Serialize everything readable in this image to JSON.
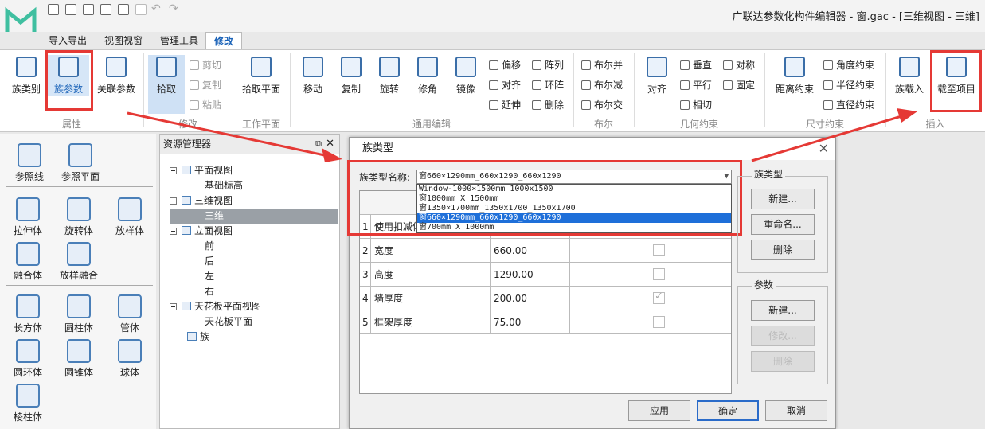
{
  "window": {
    "title": "广联达参数化构件编辑器 - 窗.gac - [三维视图 - 三维]"
  },
  "tabs": [
    "导入导出",
    "视图视窗",
    "管理工具",
    "修改"
  ],
  "ribbon": {
    "groups": {
      "attr": "属性",
      "modify": "修改",
      "workplane": "工作平面",
      "edit": "通用编辑",
      "bool": "布尔",
      "geo": "几何约束",
      "dim": "尺寸约束",
      "insert": "插入"
    },
    "family_category": "族类别",
    "family_params": "族参数",
    "linked_params": "关联参数",
    "pick": "拾取",
    "cut": "剪切",
    "copy": "复制",
    "paste": "粘贴",
    "pick_plane": "拾取平面",
    "move": "移动",
    "duplicate": "复制",
    "rotate": "旋转",
    "trim": "修角",
    "mirror": "镜像",
    "offset": "偏移",
    "align_small": "对齐",
    "extend": "延伸",
    "array": "阵列",
    "ring": "环阵",
    "delete": "删除",
    "bool_union": "布尔并",
    "bool_sub": "布尔减",
    "bool_inter": "布尔交",
    "align": "对齐",
    "perpendicular": "垂直",
    "parallel": "平行",
    "tangent": "相切",
    "symmetric": "对称",
    "fixed": "固定",
    "distance": "距离约束",
    "angle": "角度约束",
    "radius": "半径约束",
    "diameter": "直径约束",
    "load_family": "族载入",
    "load_to_project": "载至项目"
  },
  "left_panel": {
    "items": [
      "参照线",
      "参照平面",
      "拉伸体",
      "旋转体",
      "放样体",
      "融合体",
      "放样融合",
      "长方体",
      "圆柱体",
      "管体",
      "圆环体",
      "圆锥体",
      "球体",
      "棱柱体"
    ]
  },
  "resource_manager": {
    "title": "资源管理器",
    "nodes": [
      "平面视图",
      "基础标高",
      "三维视图",
      "三维",
      "立面视图",
      "前",
      "后",
      "左",
      "右",
      "天花板平面视图",
      "天花板平面",
      "族"
    ]
  },
  "dialog": {
    "title": "族类型",
    "type_name_label": "族类型名称:",
    "type_name_value": "窗660×1290mm_660x1290_660x1290",
    "options": [
      "Window-1000×1500mm_1000x1500",
      "窗1000mm X 1500mm",
      "窗1350×1700mm_1350x1700_1350x1700",
      "窗660×1290mm_660x1290_660x1290",
      "窗700mm X 1000mm"
    ],
    "rows": [
      {
        "idx": "1",
        "name": "使用扣减体",
        "value": "",
        "checked": false
      },
      {
        "idx": "2",
        "name": "宽度",
        "value": "660.00",
        "checked": false
      },
      {
        "idx": "3",
        "name": "高度",
        "value": "1290.00",
        "checked": false
      },
      {
        "idx": "4",
        "name": "墙厚度",
        "value": "200.00",
        "checked": true
      },
      {
        "idx": "5",
        "name": "框架厚度",
        "value": "75.00",
        "checked": false
      }
    ],
    "family_type_group": "族类型",
    "new": "新建...",
    "rename": "重命名...",
    "delete": "删除",
    "params_group": "参数",
    "param_new": "新建...",
    "param_modify": "修改...",
    "param_delete": "删除",
    "apply": "应用",
    "ok": "确定",
    "cancel": "取消"
  },
  "colors": {
    "accent": "#1b63b8",
    "highlight": "#e53935",
    "selection": "#1e6fd9"
  }
}
